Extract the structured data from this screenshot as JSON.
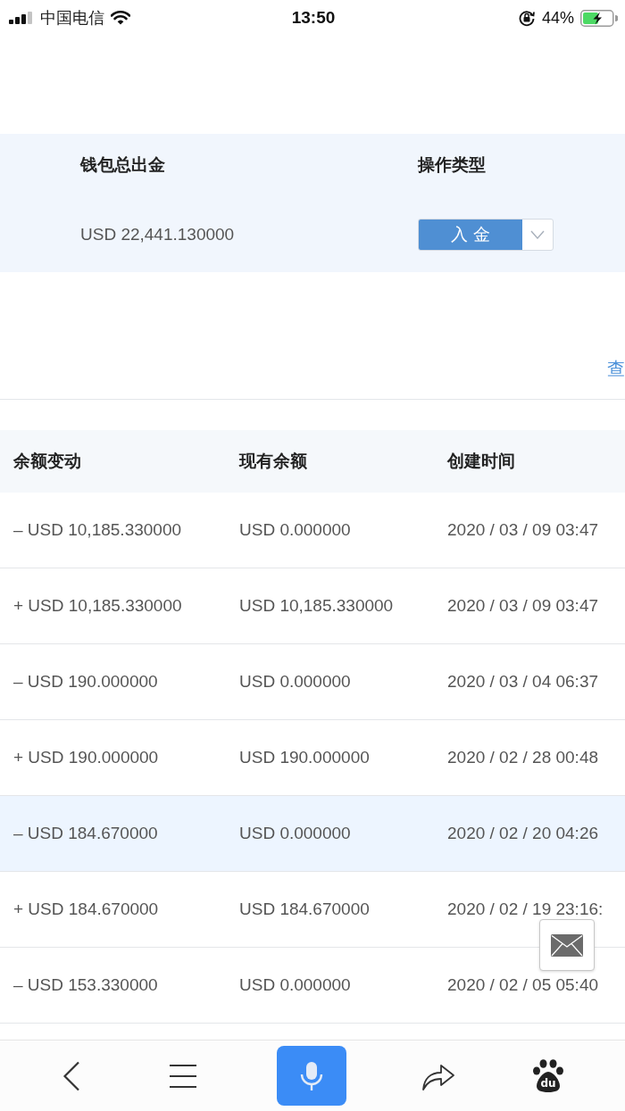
{
  "status_bar": {
    "carrier": "中国电信",
    "time": "13:50",
    "battery": "44%"
  },
  "summary": {
    "wallet_total_withdrawal": {
      "label": "钱包总出金",
      "value": "USD 22,441.130000"
    },
    "operation_type": {
      "label": "操作类型",
      "value": "入 金"
    }
  },
  "link": "查",
  "table": {
    "columns": [
      "余额变动",
      "现有余额",
      "创建时间"
    ],
    "rows": [
      {
        "change": "– USD 10,185.330000",
        "balance": "USD 0.000000",
        "created": "2020 / 03 / 09 03:47",
        "selected": false
      },
      {
        "change": "+ USD 10,185.330000",
        "balance": "USD 10,185.330000",
        "created": "2020 / 03 / 09 03:47",
        "selected": false
      },
      {
        "change": "– USD 190.000000",
        "balance": "USD 0.000000",
        "created": "2020 / 03 / 04 06:37",
        "selected": false
      },
      {
        "change": "+ USD 190.000000",
        "balance": "USD 190.000000",
        "created": "2020 / 02 / 28 00:48",
        "selected": false
      },
      {
        "change": "– USD 184.670000",
        "balance": "USD 0.000000",
        "created": "2020 / 02 / 20 04:26",
        "selected": true
      },
      {
        "change": "+ USD 184.670000",
        "balance": "USD 184.670000",
        "created": "2020 / 02 / 19 23:16:",
        "selected": false
      },
      {
        "change": "– USD 153.330000",
        "balance": "USD 0.000000",
        "created": "2020 / 02 / 05 05:40",
        "selected": false
      }
    ]
  },
  "bottom_bar": {
    "logo_text": "du"
  }
}
